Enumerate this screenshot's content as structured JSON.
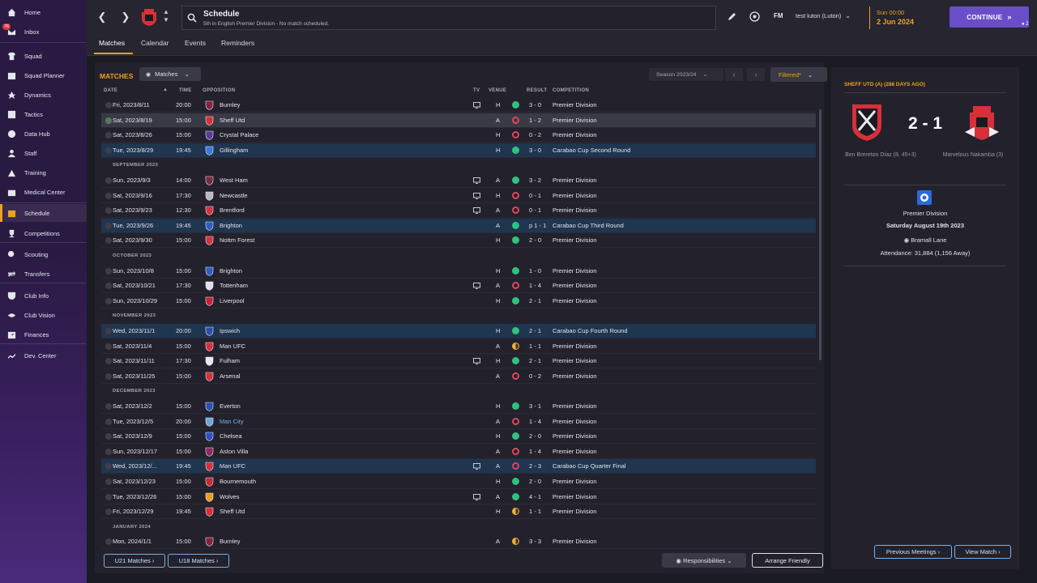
{
  "sidebar": {
    "items": [
      {
        "label": "Home",
        "icon": "home-icon"
      },
      {
        "label": "Inbox",
        "icon": "inbox-icon",
        "badge": "76"
      },
      {
        "label": "Squad",
        "icon": "shirt-icon"
      },
      {
        "label": "Squad Planner",
        "icon": "planner-icon"
      },
      {
        "label": "Dynamics",
        "icon": "dynamics-icon"
      },
      {
        "label": "Tactics",
        "icon": "tactics-icon"
      },
      {
        "label": "Data Hub",
        "icon": "data-hub-icon"
      },
      {
        "label": "Staff",
        "icon": "staff-icon"
      },
      {
        "label": "Training",
        "icon": "training-icon"
      },
      {
        "label": "Medical Center",
        "icon": "medical-icon"
      },
      {
        "label": "Schedule",
        "icon": "schedule-icon",
        "active": true
      },
      {
        "label": "Competitions",
        "icon": "trophy-icon"
      },
      {
        "label": "Scouting",
        "icon": "scouting-icon"
      },
      {
        "label": "Transfers",
        "icon": "transfers-icon"
      },
      {
        "label": "Club Info",
        "icon": "shield-icon"
      },
      {
        "label": "Club Vision",
        "icon": "vision-icon"
      },
      {
        "label": "Finances",
        "icon": "finances-icon"
      },
      {
        "label": "Dev. Center",
        "icon": "dev-center-icon"
      }
    ]
  },
  "topbar": {
    "title": "Schedule",
    "subtitle": "5th in English Premier Division - No match scheduled.",
    "fm_logo": "FM",
    "manager": "test luton (Luton)",
    "time": "Sun 00:00",
    "date": "2 Jun 2024",
    "continue_label": "CONTINUE",
    "user_count": "2"
  },
  "tabs": [
    "Matches",
    "Calendar",
    "Events",
    "Reminders"
  ],
  "matches": {
    "section_title": "MATCHES",
    "view_dropdown": "Matches",
    "season": "Season 2023/24",
    "filter": "Filtered*",
    "columns": {
      "date": "DATE",
      "time": "TIME",
      "opposition": "OPPOSITION",
      "tv": "TV",
      "venue": "VENUE",
      "result": "RESULT",
      "competition": "COMPETITION"
    },
    "rows": [
      {
        "kind": "match",
        "date": "Fri, 2023/8/11",
        "time": "20:00",
        "opp": "Burnley",
        "crest": "#8a2040",
        "tv": true,
        "venue": "H",
        "outcome": "win",
        "result": "3 - 0",
        "comp": "Premier Division"
      },
      {
        "kind": "match",
        "date": "Sat, 2023/8/19",
        "time": "15:00",
        "opp": "Sheff Utd",
        "crest": "#d8303a",
        "tv": false,
        "venue": "A",
        "outcome": "loss",
        "result": "1 - 2",
        "comp": "Premier Division",
        "selected": true
      },
      {
        "kind": "match",
        "date": "Sat, 2023/8/26",
        "time": "15:00",
        "opp": "Crystal Palace",
        "crest": "#5a3aa0",
        "tv": false,
        "venue": "H",
        "outcome": "loss",
        "result": "0 - 2",
        "comp": "Premier Division"
      },
      {
        "kind": "match",
        "date": "Tue, 2023/8/29",
        "time": "19:45",
        "opp": "Gillingham",
        "crest": "#3a7ad8",
        "tv": false,
        "venue": "H",
        "outcome": "win",
        "result": "3 - 0",
        "comp": "Carabao Cup Second Round",
        "cup": true
      },
      {
        "kind": "month",
        "label": "SEPTEMBER 2023"
      },
      {
        "kind": "match",
        "date": "Sun, 2023/9/3",
        "time": "14:00",
        "opp": "West Ham",
        "crest": "#7a2a40",
        "tv": true,
        "venue": "A",
        "outcome": "win",
        "result": "3 - 2",
        "comp": "Premier Division"
      },
      {
        "kind": "match",
        "date": "Sat, 2023/9/16",
        "time": "17:30",
        "opp": "Newcastle",
        "crest": "#b8b8c0",
        "tv": true,
        "venue": "H",
        "outcome": "loss",
        "result": "0 - 1",
        "comp": "Premier Division"
      },
      {
        "kind": "match",
        "date": "Sat, 2023/9/23",
        "time": "12:30",
        "opp": "Brentford",
        "crest": "#d83040",
        "tv": true,
        "venue": "A",
        "outcome": "loss",
        "result": "0 - 1",
        "comp": "Premier Division"
      },
      {
        "kind": "match",
        "date": "Tue, 2023/9/26",
        "time": "19:45",
        "opp": "Brighton",
        "crest": "#2a60c0",
        "tv": false,
        "venue": "A",
        "outcome": "win",
        "result": "p 1 - 1",
        "comp": "Carabao Cup Third Round",
        "cup": true
      },
      {
        "kind": "match",
        "date": "Sat, 2023/9/30",
        "time": "15:00",
        "opp": "Nottm Forest",
        "crest": "#d83040",
        "tv": false,
        "venue": "H",
        "outcome": "win",
        "result": "2 - 0",
        "comp": "Premier Division"
      },
      {
        "kind": "month",
        "label": "OCTOBER 2023"
      },
      {
        "kind": "match",
        "date": "Sun, 2023/10/8",
        "time": "15:00",
        "opp": "Brighton",
        "crest": "#2a60c0",
        "tv": false,
        "venue": "H",
        "outcome": "win",
        "result": "1 - 0",
        "comp": "Premier Division"
      },
      {
        "kind": "match",
        "date": "Sat, 2023/10/21",
        "time": "17:30",
        "opp": "Tottenham",
        "crest": "#e0e0e8",
        "tv": true,
        "venue": "A",
        "outcome": "loss",
        "result": "1 - 4",
        "comp": "Premier Division"
      },
      {
        "kind": "match",
        "date": "Sun, 2023/10/29",
        "time": "15:00",
        "opp": "Liverpool",
        "crest": "#c8203a",
        "tv": false,
        "venue": "H",
        "outcome": "win",
        "result": "2 - 1",
        "comp": "Premier Division"
      },
      {
        "kind": "month",
        "label": "NOVEMBER 2023"
      },
      {
        "kind": "match",
        "date": "Wed, 2023/11/1",
        "time": "20:00",
        "opp": "Ipswich",
        "crest": "#2a50b0",
        "tv": false,
        "venue": "H",
        "outcome": "win",
        "result": "2 - 1",
        "comp": "Carabao Cup Fourth Round",
        "cup": true
      },
      {
        "kind": "match",
        "date": "Sat, 2023/11/4",
        "time": "15:00",
        "opp": "Man UFC",
        "crest": "#d8303a",
        "tv": false,
        "venue": "A",
        "outcome": "draw",
        "result": "1 - 1",
        "comp": "Premier Division"
      },
      {
        "kind": "match",
        "date": "Sat, 2023/11/11",
        "time": "17:30",
        "opp": "Fulham",
        "crest": "#e8e8f0",
        "tv": true,
        "venue": "H",
        "outcome": "win",
        "result": "2 - 1",
        "comp": "Premier Division"
      },
      {
        "kind": "match",
        "date": "Sat, 2023/11/25",
        "time": "15:00",
        "opp": "Arsenal",
        "crest": "#d8303a",
        "tv": false,
        "venue": "A",
        "outcome": "loss",
        "result": "0 - 2",
        "comp": "Premier Division"
      },
      {
        "kind": "month",
        "label": "DECEMBER 2023"
      },
      {
        "kind": "match",
        "date": "Sat, 2023/12/2",
        "time": "15:00",
        "opp": "Everton",
        "crest": "#2a50b0",
        "tv": false,
        "venue": "H",
        "outcome": "win",
        "result": "3 - 1",
        "comp": "Premier Division"
      },
      {
        "kind": "match",
        "date": "Tue, 2023/12/5",
        "time": "20:00",
        "opp": "Man City",
        "crest": "#6aa8e0",
        "tv": false,
        "venue": "A",
        "outcome": "loss",
        "result": "1 - 4",
        "comp": "Premier Division",
        "link": true
      },
      {
        "kind": "match",
        "date": "Sat, 2023/12/9",
        "time": "15:00",
        "opp": "Chelsea",
        "crest": "#2a50c8",
        "tv": false,
        "venue": "H",
        "outcome": "win",
        "result": "2 - 0",
        "comp": "Premier Division"
      },
      {
        "kind": "match",
        "date": "Sun, 2023/12/17",
        "time": "15:00",
        "opp": "Aston Villa",
        "crest": "#8a2a60",
        "tv": false,
        "venue": "A",
        "outcome": "loss",
        "result": "1 - 4",
        "comp": "Premier Division"
      },
      {
        "kind": "match",
        "date": "Wed, 2023/12/...",
        "time": "19:45",
        "opp": "Man UFC",
        "crest": "#d8303a",
        "tv": true,
        "venue": "A",
        "outcome": "loss",
        "result": "2 - 3",
        "comp": "Carabao Cup Quarter Final",
        "cup": true
      },
      {
        "kind": "match",
        "date": "Sat, 2023/12/23",
        "time": "15:00",
        "opp": "Bournemouth",
        "crest": "#c82838",
        "tv": false,
        "venue": "H",
        "outcome": "win",
        "result": "2 - 0",
        "comp": "Premier Division"
      },
      {
        "kind": "match",
        "date": "Tue, 2023/12/26",
        "time": "15:00",
        "opp": "Wolves",
        "crest": "#e8a020",
        "tv": true,
        "venue": "A",
        "outcome": "win",
        "result": "4 - 1",
        "comp": "Premier Division"
      },
      {
        "kind": "match",
        "date": "Fri, 2023/12/29",
        "time": "19:45",
        "opp": "Sheff Utd",
        "crest": "#d8303a",
        "tv": false,
        "venue": "H",
        "outcome": "draw",
        "result": "1 - 1",
        "comp": "Premier Division"
      },
      {
        "kind": "month",
        "label": "JANUARY 2024"
      },
      {
        "kind": "match",
        "date": "Mon, 2024/1/1",
        "time": "15:00",
        "opp": "Burnley",
        "crest": "#8a2040",
        "tv": false,
        "venue": "A",
        "outcome": "draw",
        "result": "3 - 3",
        "comp": "Premier Division"
      }
    ],
    "footer": {
      "u21": "U21 Matches",
      "u18": "U18 Matches",
      "responsibilities": "Responsibilities",
      "arrange": "Arrange Friendly"
    }
  },
  "detail": {
    "title": "SHEFF UTD (A) (288 DAYS AGO)",
    "score": "2 - 1",
    "home_scorer": "Ben Brereton Díaz (8, 45+3)",
    "away_scorer": "Marvelous Nakamba (3)",
    "competition": "Premier Division",
    "date": "Saturday August 19th 2023",
    "stadium": "Bramall Lane",
    "attendance": "Attendance: 31,884 (1,156 Away)",
    "prev_meetings": "Previous Meetings",
    "view_match": "View Match"
  },
  "colors": {
    "accent": "#f0a020",
    "continue": "#6a4ec8",
    "win": "#2ec27e",
    "loss": "#e0455a",
    "draw": "#f0b030",
    "cup_row": "#1f3550"
  }
}
